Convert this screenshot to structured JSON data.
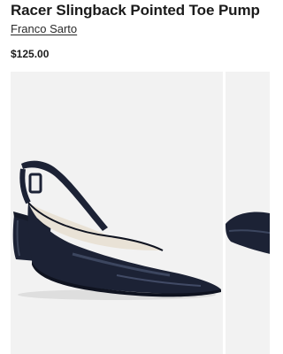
{
  "product": {
    "title": "Racer Slingback Pointed Toe Pump",
    "brand": "Franco Sarto",
    "price": "$125.00"
  },
  "gallery": {
    "images": [
      {
        "alt": "navy-patent-slingback-pump-side-view"
      },
      {
        "alt": "navy-patent-slingback-pump-next-view"
      }
    ]
  },
  "colors": {
    "shoe": "#1c2235",
    "lining": "#e9e2d6",
    "background": "#f2f2f2",
    "text": "#1b1b1b"
  }
}
